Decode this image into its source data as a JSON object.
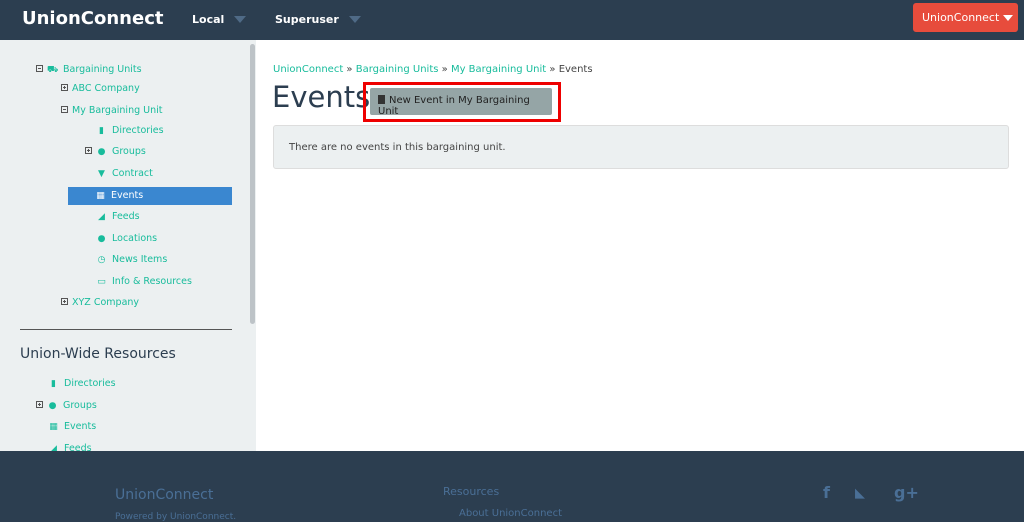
{
  "header": {
    "brand": "UnionConnect",
    "nav": [
      {
        "label": "Local"
      },
      {
        "label": "Superuser"
      }
    ],
    "user_menu": "UnionConnect"
  },
  "sidebar": {
    "tree": [
      {
        "label": "Bargaining Units",
        "icon": "truck-icon",
        "glyph": "⛟",
        "expander": "minus"
      },
      {
        "label": "ABC Company",
        "expander": "plus"
      },
      {
        "label": "My Bargaining Unit",
        "expander": "minus"
      },
      {
        "label": "Directories",
        "icon": "book-icon",
        "glyph": "▮"
      },
      {
        "label": "Groups",
        "icon": "users-icon",
        "glyph": "●",
        "expander": "plus"
      },
      {
        "label": "Contract",
        "icon": "bookmark-icon",
        "glyph": "▼"
      },
      {
        "label": "Events",
        "icon": "calendar-icon",
        "glyph": "▦",
        "active": true
      },
      {
        "label": "Feeds",
        "icon": "rss-icon",
        "glyph": "◢"
      },
      {
        "label": "Locations",
        "icon": "globe-icon",
        "glyph": "●"
      },
      {
        "label": "News Items",
        "icon": "clock-icon",
        "glyph": "◷"
      },
      {
        "label": "Info & Resources",
        "icon": "folder-open-icon",
        "glyph": "▭"
      },
      {
        "label": "XYZ Company",
        "expander": "plus"
      }
    ],
    "section_title": "Union-Wide Resources",
    "resources": [
      {
        "label": "Directories",
        "icon": "book-icon",
        "glyph": "▮"
      },
      {
        "label": "Groups",
        "icon": "users-icon",
        "glyph": "●",
        "expander": "plus"
      },
      {
        "label": "Events",
        "icon": "calendar-icon",
        "glyph": "▦"
      },
      {
        "label": "Feeds",
        "icon": "rss-icon",
        "glyph": "◢"
      }
    ]
  },
  "main": {
    "breadcrumb": [
      "UnionConnect",
      "Bargaining Units",
      "My Bargaining Unit",
      "Events"
    ],
    "title": "Events",
    "new_button": "New Event in My Bargaining Unit",
    "empty_message": "There are no events in this bargaining unit."
  },
  "footer": {
    "brand": "UnionConnect",
    "powered": "Powered by UnionConnect.",
    "resources_title": "Resources",
    "about_link": "About UnionConnect",
    "social": [
      {
        "icon": "facebook-icon",
        "glyph": "f"
      },
      {
        "icon": "twitter-icon",
        "glyph": "🐦"
      },
      {
        "icon": "google-plus-icon",
        "glyph": "g+"
      }
    ]
  },
  "colors": {
    "nav_bg": "#2c3e50",
    "accent_green": "#18bc9c",
    "active_blue": "#3a87d0",
    "danger_red": "#e74c3c"
  }
}
